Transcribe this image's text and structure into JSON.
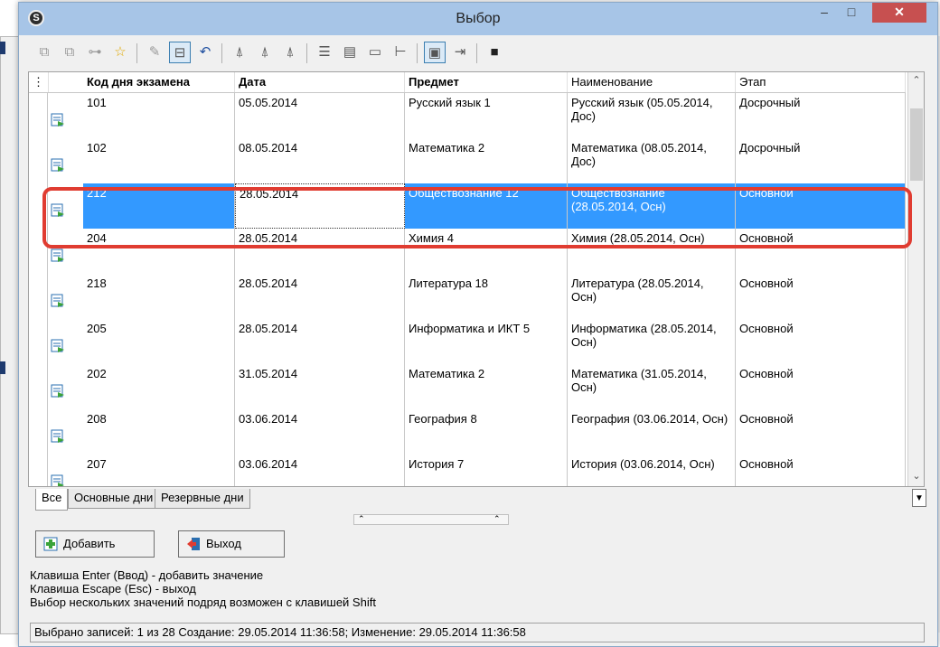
{
  "window": {
    "title": "Выбор",
    "min_glyph": "–",
    "max_glyph": "□",
    "close_glyph": "✕",
    "app_glyph": "S"
  },
  "toolbar": {
    "icons": [
      "copy-icon",
      "copy-multiple-icon",
      "tree-icon",
      "favorite-star-icon",
      "edit-icon",
      "frame-icon",
      "undo-icon",
      "filter-icon",
      "filter-edit-icon",
      "filter-clear-icon",
      "collapse-rows-icon",
      "table-icon",
      "insert-row-icon",
      "hierarchy-icon",
      "view-form-icon",
      "export-icon",
      "save-icon"
    ]
  },
  "grid": {
    "columns": [
      "Код дня экзамена",
      "Дата",
      "Предмет",
      "Наименование",
      "Этап"
    ],
    "rows": [
      {
        "code": "101",
        "date": "05.05.2014",
        "subject": "Русский язык 1",
        "name": "Русский язык (05.05.2014, Дос)",
        "stage": "Досрочный"
      },
      {
        "code": "102",
        "date": "08.05.2014",
        "subject": "Математика 2",
        "name": "Математика (08.05.2014, Дос)",
        "stage": "Досрочный"
      },
      {
        "code": "212",
        "date": "28.05.2014",
        "subject": "Обществознание 12",
        "name": "Обществознание (28.05.2014, Осн)",
        "stage": "Основной",
        "selected": true
      },
      {
        "code": "204",
        "date": "28.05.2014",
        "subject": "Химия 4",
        "name": "Химия (28.05.2014, Осн)",
        "stage": "Основной"
      },
      {
        "code": "218",
        "date": "28.05.2014",
        "subject": "Литература 18",
        "name": "Литература (28.05.2014, Осн)",
        "stage": "Основной"
      },
      {
        "code": "205",
        "date": "28.05.2014",
        "subject": "Информатика и ИКТ 5",
        "name": "Информатика (28.05.2014, Осн)",
        "stage": "Основной"
      },
      {
        "code": "202",
        "date": "31.05.2014",
        "subject": "Математика 2",
        "name": "Математика (31.05.2014, Осн)",
        "stage": "Основной"
      },
      {
        "code": "208",
        "date": "03.06.2014",
        "subject": "География 8",
        "name": "География (03.06.2014, Осн)",
        "stage": "Основной"
      },
      {
        "code": "207",
        "date": "03.06.2014",
        "subject": "История 7",
        "name": "История (03.06.2014, Осн)",
        "stage": "Основной"
      }
    ]
  },
  "tabs": [
    "Все",
    "Основные дни",
    "Резервные дни"
  ],
  "buttons": {
    "add": "Добавить",
    "exit": "Выход"
  },
  "hints": [
    "Клавиша Enter (Ввод) - добавить значение",
    "Клавиша Escape (Esc) - выход",
    "Выбор нескольких значений подряд возможен с клавишей Shift"
  ],
  "status": "Выбрано записей: 1 из 28 Создание: 29.05.2014 11:36:58; Изменение: 29.05.2014 11:36:58",
  "colors": {
    "selection": "#3399ff",
    "highlight": "#e03c31",
    "titlebar": "#a7c5e7",
    "close": "#c75050"
  }
}
